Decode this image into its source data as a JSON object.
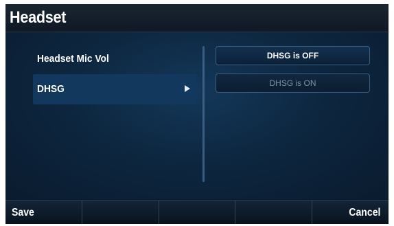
{
  "title": "Headset",
  "menu": {
    "items": [
      {
        "label": "Headset Mic Vol"
      },
      {
        "label": "DHSG"
      }
    ]
  },
  "options": [
    {
      "label": "DHSG is OFF"
    },
    {
      "label": "DHSG is ON"
    }
  ],
  "softkeys": [
    {
      "label": "Save"
    },
    {
      "label": ""
    },
    {
      "label": ""
    },
    {
      "label": ""
    },
    {
      "label": "Cancel"
    }
  ],
  "colors": {
    "background": "#0b1a2b",
    "selected_row": "#12385e",
    "option_border": "#3a5f85",
    "text": "#ffffff",
    "dim_text": "#7f8fa2"
  },
  "icons": {
    "submenu_arrow": "triangle-right-icon"
  }
}
